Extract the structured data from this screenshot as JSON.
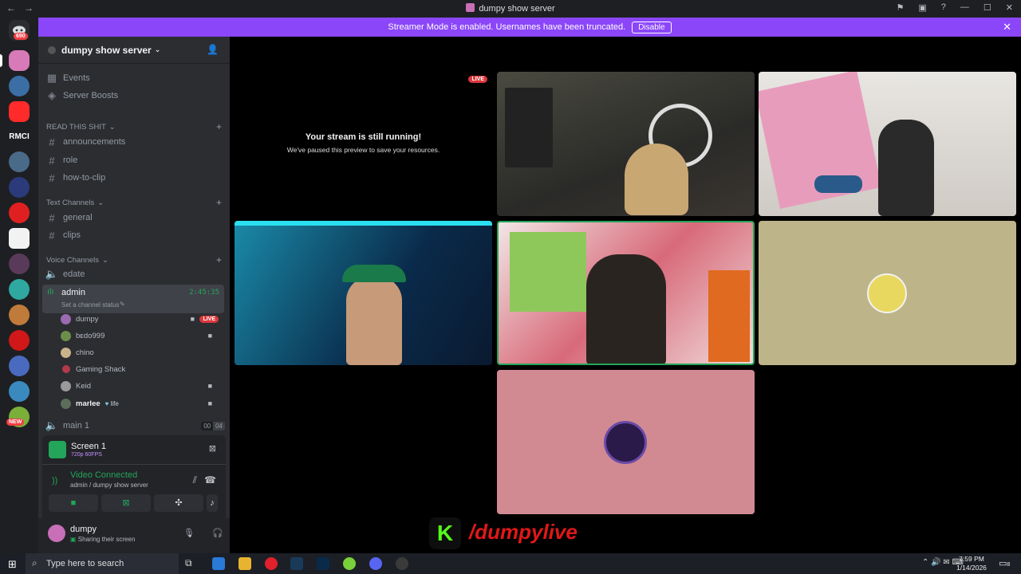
{
  "window": {
    "title": "dumpy show server",
    "nav_back": "←",
    "nav_forward": "→"
  },
  "servers": {
    "top_badge": "690",
    "rmci_label": "RMCI",
    "new_badge": "NEW"
  },
  "banner": {
    "message": "Streamer Mode is enabled. Usernames have been truncated.",
    "disable_label": "Disable",
    "close": "✕"
  },
  "sidebar": {
    "server_name": "dumpy show server",
    "items": [
      {
        "icon": "calendar-icon",
        "label": "Events"
      },
      {
        "icon": "boost-icon",
        "label": "Server Boosts"
      }
    ],
    "categories": [
      {
        "label": "READ THIS SHIT",
        "channels": [
          "announcements",
          "role",
          "how-to-clip"
        ]
      },
      {
        "label": "Text Channels",
        "channels": [
          "general",
          "clips"
        ]
      },
      {
        "label": "Voice Channels",
        "channels": [
          "edate"
        ]
      }
    ],
    "active_voice": {
      "name": "admin",
      "timer": "2:45:35",
      "status_placeholder": "Set a channel status"
    },
    "voice_users": [
      {
        "name": "dumpy",
        "color": "#9a6bb0",
        "video": true,
        "live": "LIVE"
      },
      {
        "name": "bᴇdo999",
        "color": "#6a8f4a",
        "video": true
      },
      {
        "name": "chino",
        "color": "#c9b38a",
        "video": false
      },
      {
        "name": "Gaming Shack",
        "color": "#b23a4a",
        "video": false
      },
      {
        "name": "Keid",
        "color": "#9a9a9a",
        "video": true
      },
      {
        "name": "marlee",
        "color": "#5a6e5a",
        "video": true,
        "tag": "life"
      }
    ],
    "other_voice": {
      "name": "main 1",
      "count_a": "00",
      "count_b": "04"
    }
  },
  "stream_panel": {
    "title": "Screen 1",
    "quality": "720p 60FPS",
    "connection": "Video Connected",
    "location": "admin / dumpy show server"
  },
  "user_panel": {
    "username": "dumpy",
    "status": "Sharing their screen"
  },
  "main": {
    "paused_title": "Your stream is still running!",
    "paused_subtitle": "We've paused this preview to save your resources.",
    "live_badge": "LIVE",
    "overlay_text": "/dumpylive",
    "overlay_logo_letter": "K"
  },
  "taskbar": {
    "search_placeholder": "Type here to search",
    "time": "7:59 PM",
    "date": "1/14/2026",
    "notif_count": "8"
  },
  "colors": {
    "banner": "#8b46f9",
    "sidebar": "#2b2d31",
    "server_rail": "#1e1f22",
    "connected_green": "#23a55a",
    "live_red": "#da373c"
  }
}
